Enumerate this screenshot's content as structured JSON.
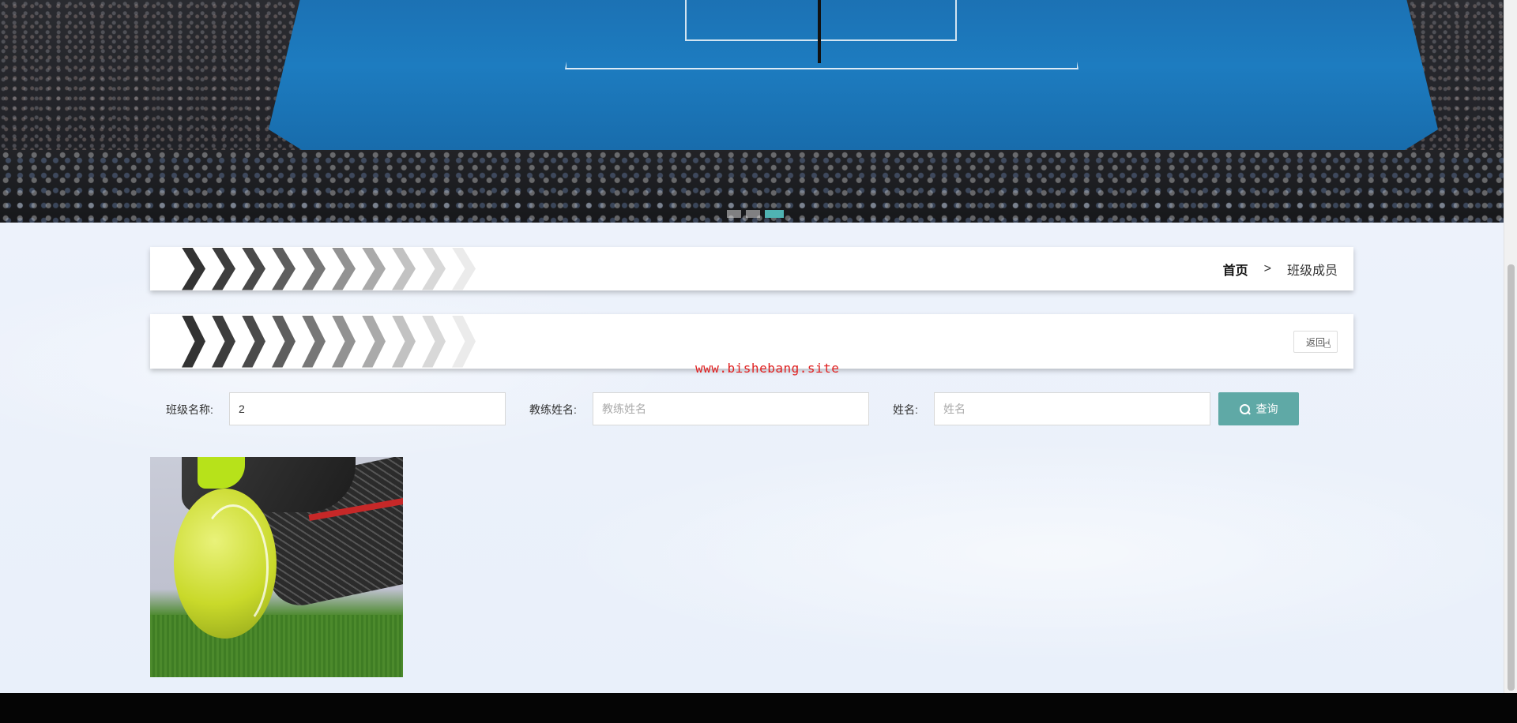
{
  "banner": {
    "alt": "tennis-arena-banner",
    "dots": 3,
    "active_dot": 3
  },
  "breadcrumb": {
    "home": "首页",
    "separator": ">",
    "current": "班级成员"
  },
  "actions": {
    "back_label": "返回"
  },
  "watermark": "www.bishebang.site",
  "search": {
    "class_name_label": "班级名称:",
    "class_name_value": "2",
    "coach_name_label": "教练姓名:",
    "coach_name_placeholder": "教练姓名",
    "name_label": "姓名:",
    "name_placeholder": "姓名",
    "query_label": "查询"
  },
  "results": [
    {
      "image": "tennis-ball-photo"
    }
  ],
  "colors": {
    "accent": "#5fa9a6",
    "active_dot": "#4fb3b3",
    "watermark": "#e02020"
  }
}
